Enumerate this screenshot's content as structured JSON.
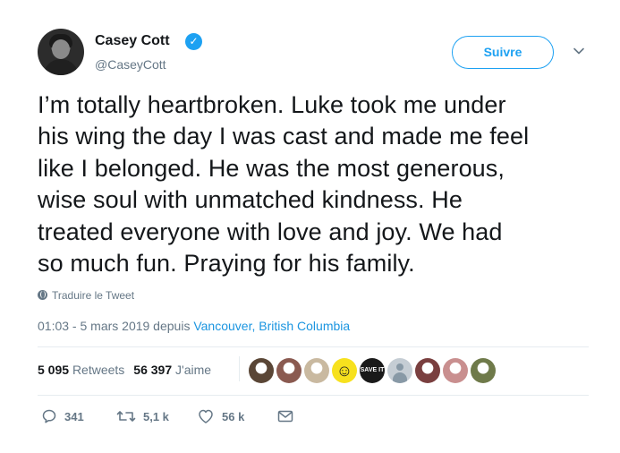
{
  "author": {
    "name": "Casey Cott",
    "handle": "@CaseyCott",
    "verified_glyph": "✓"
  },
  "follow_button_label": "Suivre",
  "tweet_lines": [
    "I’m totally heartbroken. Luke took me under",
    "his wing the day I was cast and made me feel",
    "like I belonged. He was the most generous,",
    "wise soul with unmatched kindness. He",
    "treated everyone with love and joy. We had",
    "so much fun. Praying for his family."
  ],
  "translate_label": "Traduire le Tweet",
  "meta": {
    "time_date": "01:03 - 5 mars 2019 depuis",
    "location": "Vancouver, British Columbia"
  },
  "stats": {
    "retweets_count": "5 095",
    "retweets_label": "Retweets",
    "likes_count": "56 397",
    "likes_label": "J'aime"
  },
  "liker_avatars": [
    {
      "kind": "photo",
      "color": "#5a4636"
    },
    {
      "kind": "photo",
      "color": "#8a5a50"
    },
    {
      "kind": "photo",
      "color": "#c9b9a0"
    },
    {
      "kind": "smiley",
      "glyph": "☺",
      "color": "#f7e11e"
    },
    {
      "kind": "badge",
      "text": "SAVE IT",
      "color": "#1a1a1a"
    },
    {
      "kind": "default",
      "color": "#c5cdd4"
    },
    {
      "kind": "photo",
      "color": "#7a3f3f"
    },
    {
      "kind": "photo",
      "color": "#c98f8f"
    },
    {
      "kind": "photo",
      "color": "#6f7a4a"
    }
  ],
  "actions": {
    "replies": "341",
    "retweets": "5,1 k",
    "likes": "56 k"
  },
  "colors": {
    "accent": "#1da1f2",
    "link": "#1b95e0",
    "muted": "#657786",
    "text": "#14171a"
  }
}
